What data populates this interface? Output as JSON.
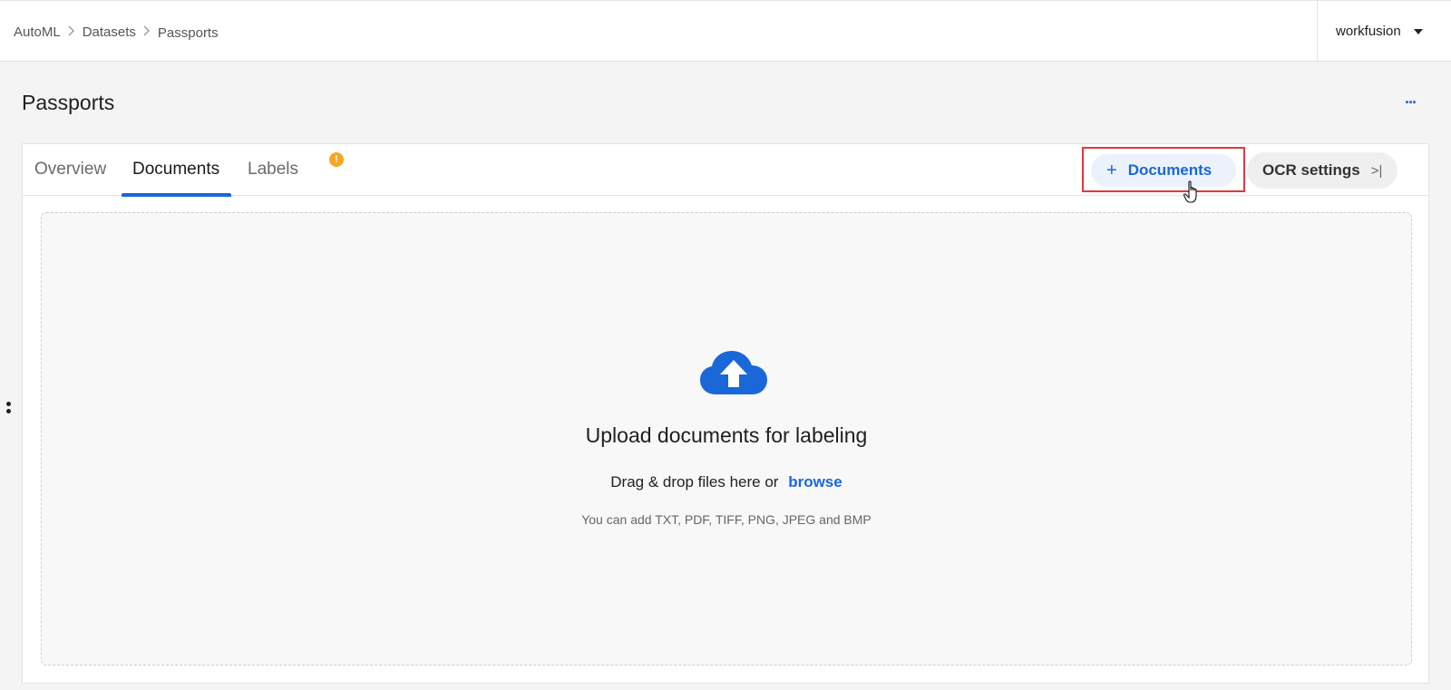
{
  "breadcrumb": {
    "items": [
      "AutoML",
      "Datasets",
      "Passports"
    ]
  },
  "account": {
    "name": "workfusion"
  },
  "page": {
    "title": "Passports",
    "more_label": "..."
  },
  "tabs": [
    {
      "label": "Overview",
      "active": false
    },
    {
      "label": "Documents",
      "active": true
    },
    {
      "label": "Labels",
      "active": false,
      "badge": "!"
    }
  ],
  "actions": {
    "add_documents_label": "Documents",
    "add_documents_icon": "plus-icon",
    "ocr_settings_label": "OCR settings",
    "ocr_settings_icon": "collapse-right-icon"
  },
  "upload": {
    "title": "Upload documents for labeling",
    "drag_text": "Drag & drop files here or",
    "browse_label": "browse",
    "formats_text": "You can add TXT, PDF, TIFF, PNG, JPEG and BMP",
    "icon": "cloud-upload-icon"
  },
  "colors": {
    "accent": "#1a67d8",
    "highlight": "#e0383e",
    "badge": "#f5a623"
  }
}
